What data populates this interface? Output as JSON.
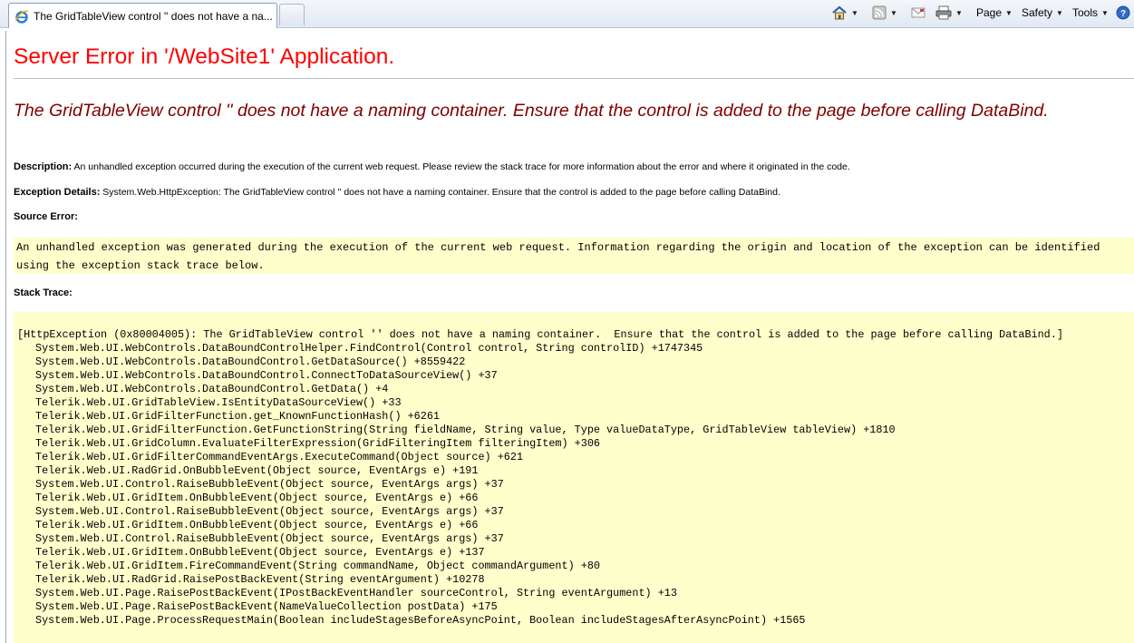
{
  "browser": {
    "tab_title": "The GridTableView control '' does not have a na...",
    "commands": {
      "page": "Page",
      "safety": "Safety",
      "tools": "Tools"
    },
    "icons": [
      "ie-favicon-icon",
      "home-icon",
      "feeds-icon",
      "mail-icon",
      "print-icon",
      "help-icon"
    ]
  },
  "page": {
    "title": "Server Error in '/WebSite1' Application.",
    "error_message": "The GridTableView control '' does not have a naming container.  Ensure that the control is added to the page before calling DataBind.",
    "description_label": "Description:",
    "description_text": "An unhandled exception occurred during the execution of the current web request. Please review the stack trace for more information about the error and where it originated in the code.",
    "exception_label": "Exception Details:",
    "exception_text": "System.Web.HttpException: The GridTableView control '' does not have a naming container.  Ensure that the control is added to the page before calling DataBind.",
    "source_error_label": "Source Error:",
    "source_error_text": "An unhandled exception was generated during the execution of the current web request. Information regarding the origin and location of the exception can be identified using the exception stack trace below.",
    "stack_trace_label": "Stack Trace:",
    "stack_trace_header": "[HttpException (0x80004005): The GridTableView control '' does not have a naming container.  Ensure that the control is added to the page before calling DataBind.]",
    "stack_trace": [
      "System.Web.UI.WebControls.DataBoundControlHelper.FindControl(Control control, String controlID) +1747345",
      "System.Web.UI.WebControls.DataBoundControl.GetDataSource() +8559422",
      "System.Web.UI.WebControls.DataBoundControl.ConnectToDataSourceView() +37",
      "System.Web.UI.WebControls.DataBoundControl.GetData() +4",
      "Telerik.Web.UI.GridTableView.IsEntityDataSourceView() +33",
      "Telerik.Web.UI.GridFilterFunction.get_KnownFunctionHash() +6261",
      "Telerik.Web.UI.GridFilterFunction.GetFunctionString(String fieldName, String value, Type valueDataType, GridTableView tableView) +1810",
      "Telerik.Web.UI.GridColumn.EvaluateFilterExpression(GridFilteringItem filteringItem) +306",
      "Telerik.Web.UI.GridFilterCommandEventArgs.ExecuteCommand(Object source) +621",
      "Telerik.Web.UI.RadGrid.OnBubbleEvent(Object source, EventArgs e) +191",
      "System.Web.UI.Control.RaiseBubbleEvent(Object source, EventArgs args) +37",
      "Telerik.Web.UI.GridItem.OnBubbleEvent(Object source, EventArgs e) +66",
      "System.Web.UI.Control.RaiseBubbleEvent(Object source, EventArgs args) +37",
      "Telerik.Web.UI.GridItem.OnBubbleEvent(Object source, EventArgs e) +66",
      "System.Web.UI.Control.RaiseBubbleEvent(Object source, EventArgs args) +37",
      "Telerik.Web.UI.GridItem.OnBubbleEvent(Object source, EventArgs e) +137",
      "Telerik.Web.UI.GridItem.FireCommandEvent(String commandName, Object commandArgument) +80",
      "Telerik.Web.UI.RadGrid.RaisePostBackEvent(String eventArgument) +10278",
      "System.Web.UI.Page.RaisePostBackEvent(IPostBackEventHandler sourceControl, String eventArgument) +13",
      "System.Web.UI.Page.RaisePostBackEvent(NameValueCollection postData) +175",
      "System.Web.UI.Page.ProcessRequestMain(Boolean includeStagesBeforeAsyncPoint, Boolean includeStagesAfterAsyncPoint) +1565"
    ]
  },
  "colors": {
    "title_red": "#ff0000",
    "message_maroon": "#800000",
    "code_background": "#ffffcc"
  }
}
